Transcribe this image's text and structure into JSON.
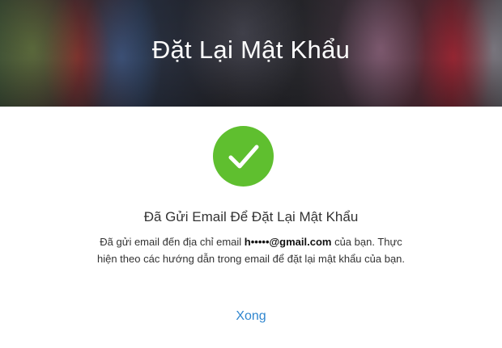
{
  "header": {
    "title": "Đặt Lại Mật Khẩu"
  },
  "status": {
    "icon": "check-circle-icon",
    "color": "#5fbf2f"
  },
  "message": {
    "heading": "Đã Gửi Email Để Đặt Lại Mật Khẩu",
    "text_before_email": "Đã gửi email đến địa chỉ email ",
    "email": "h•••••@gmail.com",
    "text_after_email": " của bạn. Thực hiện theo các hướng dẫn trong email để đặt lại mật khẩu của bạn."
  },
  "actions": {
    "done_label": "Xong",
    "link_color": "#2f86cf"
  }
}
